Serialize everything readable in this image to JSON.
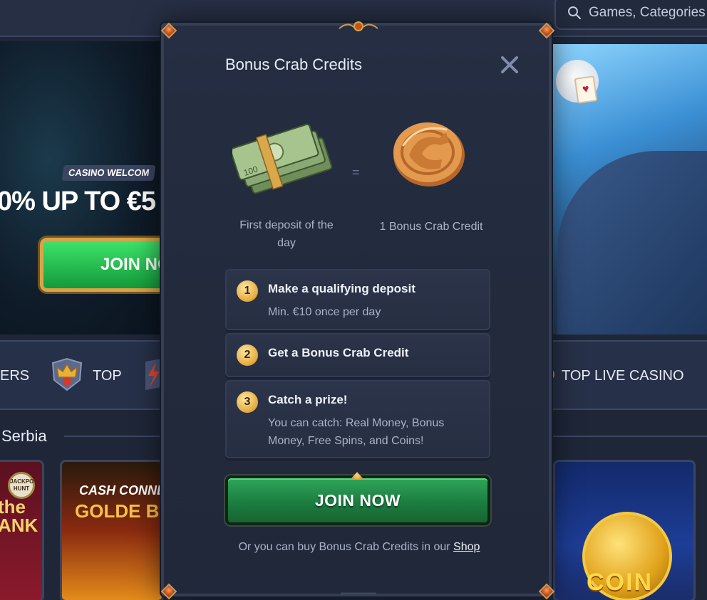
{
  "search": {
    "placeholder": "Games, Categories"
  },
  "hero_left": {
    "pill": "CASINO WELCOM",
    "headline": "0% UP TO €5",
    "join": "JOIN NO"
  },
  "categories": {
    "left_partial": "ERS",
    "top": "TOP",
    "top_live": "TOP LIVE CASINO"
  },
  "section": {
    "title": "Serbia"
  },
  "tiles": {
    "a_badge": "JACKPOT HUNT",
    "a_label": "the ANK",
    "b_label": "CASH CONNEC",
    "b_label2": "GOLDE BOOK OF",
    "c_label": "COIN"
  },
  "modal": {
    "title": "Bonus Crab Credits",
    "left_caption": "First deposit of the day",
    "equals": "=",
    "right_caption": "1 Bonus Crab Credit",
    "steps": [
      {
        "num": "1",
        "title": "Make a qualifying deposit",
        "desc": "Min. €10 once per day"
      },
      {
        "num": "2",
        "title": "Get a Bonus Crab Credit",
        "desc": ""
      },
      {
        "num": "3",
        "title": "Catch a prize!",
        "desc": "You can catch: Real Money, Bonus Money, Free Spins, and Coins!"
      }
    ],
    "join_label": "JOIN NOW",
    "footer_prefix": "Or you can buy Bonus Crab Credits in our ",
    "footer_link": "Shop"
  },
  "colors": {
    "modal_bg": "#232b3e",
    "accent_green": "#1f8a45",
    "gold": "#e5a93a",
    "text_muted": "#aab3c8"
  },
  "icons": {
    "search": "search-icon",
    "close": "close-icon",
    "money": "cash-stack-icon",
    "coin": "crab-coin-icon",
    "crown": "crown-icon",
    "bolt": "lightning-icon"
  }
}
